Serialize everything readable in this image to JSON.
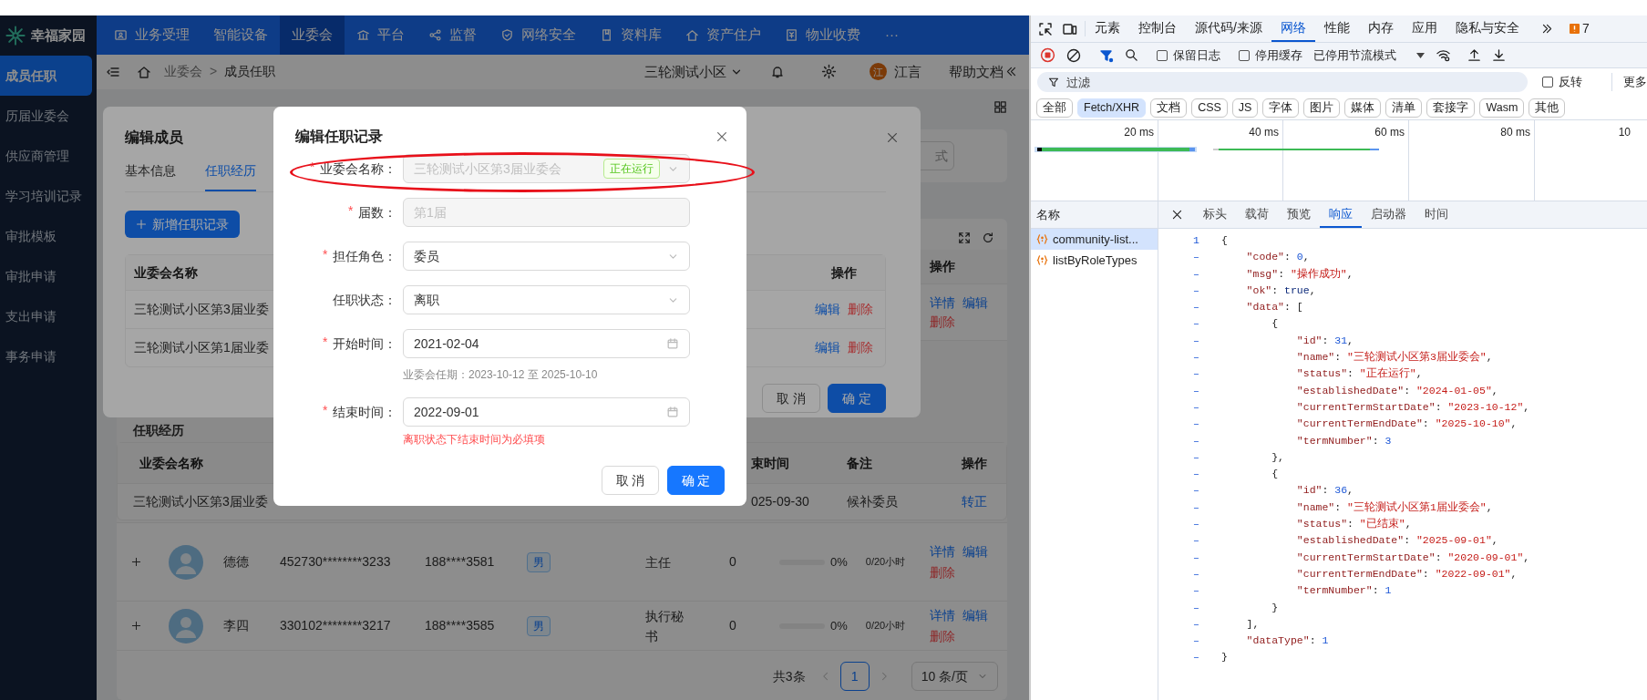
{
  "sidebar": {
    "logo": "幸福家园",
    "items": [
      {
        "label": "成员任职",
        "selected": true
      },
      {
        "label": "历届业委会",
        "selected": false
      },
      {
        "label": "供应商管理",
        "selected": false
      },
      {
        "label": "学习培训记录",
        "selected": false
      },
      {
        "label": "审批模板",
        "selected": false
      },
      {
        "label": "审批申请",
        "selected": false
      },
      {
        "label": "支出申请",
        "selected": false
      },
      {
        "label": "事务申请",
        "selected": false
      }
    ]
  },
  "top_nav": {
    "items": [
      {
        "label": "业务受理",
        "selected": false
      },
      {
        "label": "智能设备",
        "selected": false
      },
      {
        "label": "业委会",
        "selected": true
      },
      {
        "label": "平台",
        "selected": false
      },
      {
        "label": "监督",
        "selected": false
      },
      {
        "label": "网络安全",
        "selected": false
      },
      {
        "label": "资料库",
        "selected": false
      },
      {
        "label": "资产住户",
        "selected": false
      },
      {
        "label": "物业收费",
        "selected": false
      }
    ],
    "more": "···"
  },
  "header": {
    "breadcrumb": [
      "业委会",
      "成员任职"
    ],
    "separator": ">",
    "community": "三轮测试小区",
    "avatar": "江",
    "user": "江言",
    "help": "帮助文档"
  },
  "background": {
    "search_value": "式",
    "member_table": {
      "action_header": "操作",
      "first_row_actions": [
        {
          "label": "详情",
          "kind": "link"
        },
        {
          "label": "编辑",
          "kind": "link"
        },
        {
          "label": "删除",
          "kind": "danger"
        }
      ],
      "history": {
        "title": "任职经历",
        "columns": [
          "业委会名称",
          "束时间",
          "备注",
          "操作"
        ],
        "rows": [
          {
            "name": "三轮测试小区第3届业委",
            "end": "025-09-30",
            "note": "候补委员",
            "action": "转正"
          }
        ]
      },
      "rows": [
        {
          "name": "德德",
          "id_number": "452730********3233",
          "phone": "188****3581",
          "gender": "男",
          "role": "主任",
          "count": "0",
          "level": 0,
          "percent": "0%",
          "hours": "0/20小时",
          "actions": [
            {
              "label": "详情",
              "kind": "link"
            },
            {
              "label": "编辑",
              "kind": "link"
            },
            {
              "label": "删除",
              "kind": "danger"
            }
          ]
        },
        {
          "name": "李四",
          "id_number": "330102********3217",
          "phone": "188****3585",
          "gender": "男",
          "role": "执行秘书",
          "count": "0",
          "level": 0,
          "percent": "0%",
          "hours": "0/20小时",
          "actions": [
            {
              "label": "详情",
              "kind": "link"
            },
            {
              "label": "编辑",
              "kind": "link"
            },
            {
              "label": "删除",
              "kind": "danger"
            }
          ]
        }
      ]
    },
    "pagination": {
      "total": "共3条",
      "pages": [
        {
          "label": "1",
          "selected": true
        }
      ],
      "page_size": "10 条/页"
    }
  },
  "member_modal": {
    "title": "编辑成员",
    "tabs": [
      {
        "label": "基本信息",
        "selected": false
      },
      {
        "label": "任职经历",
        "selected": true
      }
    ],
    "add_button": "新增任职记录",
    "table": {
      "columns": [
        "业委会名称",
        "操作"
      ],
      "rows": [
        {
          "name": "三轮测试小区第3届业委",
          "actions": [
            {
              "label": "编辑",
              "kind": "link"
            },
            {
              "label": "删除",
              "kind": "danger"
            }
          ]
        },
        {
          "name": "三轮测试小区第1届业委",
          "actions": [
            {
              "label": "编辑",
              "kind": "link"
            },
            {
              "label": "删除",
              "kind": "danger"
            }
          ]
        }
      ]
    },
    "buttons": [
      {
        "label": "取 消",
        "kind": "default"
      },
      {
        "label": "确 定",
        "kind": "primary"
      }
    ]
  },
  "record_modal": {
    "title": "编辑任职记录",
    "fields": [
      {
        "mark": "*",
        "label": "业委会名称：",
        "kind": "select",
        "value": "三轮测试小区第3届业委会",
        "disabled": true,
        "tag": "正在运行"
      },
      {
        "mark": "*",
        "label": "届数：",
        "kind": "input",
        "value": "第1届",
        "disabled": true
      },
      {
        "mark": "*",
        "label": "担任角色：",
        "kind": "select",
        "value": "委员",
        "disabled": false
      },
      {
        "label": "任职状态：",
        "kind": "select",
        "value": "离职",
        "disabled": false
      },
      {
        "mark": "*",
        "label": "开始时间：",
        "kind": "date",
        "value": "2021-02-04",
        "disabled": false,
        "help": "业委会任期：2023-10-12 至 2025-10-10"
      },
      {
        "mark": "*",
        "label": "结束时间：",
        "kind": "date",
        "value": "2022-09-01",
        "disabled": false,
        "error": "离职状态下结束时间为必填项"
      }
    ],
    "buttons": [
      {
        "label": "取 消",
        "kind": "default"
      },
      {
        "label": "确 定",
        "kind": "primary"
      }
    ]
  },
  "devtools": {
    "tabs": [
      {
        "label": "元素",
        "selected": false
      },
      {
        "label": "控制台",
        "selected": false
      },
      {
        "label": "源代码/来源",
        "selected": false
      },
      {
        "label": "网络",
        "selected": true
      },
      {
        "label": "性能",
        "selected": false
      },
      {
        "label": "内存",
        "selected": false
      },
      {
        "label": "应用",
        "selected": false
      },
      {
        "label": "隐私与安全",
        "selected": false
      }
    ],
    "issues": "7",
    "checkboxes": [
      {
        "label": "保留日志",
        "checked": false
      },
      {
        "label": "停用缓存",
        "checked": false
      }
    ],
    "throttle": "已停用节流模式",
    "filter": {
      "placeholder": "过滤",
      "invert": {
        "label": "反转",
        "checked": false
      },
      "more": "更多"
    },
    "type_filters": [
      {
        "label": "全部",
        "selected": false
      },
      {
        "label": "Fetch/XHR",
        "selected": true
      },
      {
        "label": "文档",
        "selected": false
      },
      {
        "label": "CSS",
        "selected": false
      },
      {
        "label": "JS",
        "selected": false
      },
      {
        "label": "字体",
        "selected": false
      },
      {
        "label": "图片",
        "selected": false
      },
      {
        "label": "媒体",
        "selected": false
      },
      {
        "label": "清单",
        "selected": false
      },
      {
        "label": "套接字",
        "selected": false
      },
      {
        "label": "Wasm",
        "selected": false
      },
      {
        "label": "其他",
        "selected": false
      }
    ],
    "timeline_labels": [
      "20 ms",
      "40 ms",
      "60 ms",
      "80 ms",
      "10"
    ],
    "requests": {
      "header": "名称",
      "items": [
        {
          "name": "community-list...",
          "selected": true
        },
        {
          "name": "listByRoleTypes",
          "selected": false
        }
      ]
    },
    "detail_tabs": [
      {
        "label": "标头",
        "selected": false
      },
      {
        "label": "载荷",
        "selected": false
      },
      {
        "label": "预览",
        "selected": false
      },
      {
        "label": "响应",
        "selected": true
      },
      {
        "label": "启动器",
        "selected": false
      },
      {
        "label": "时间",
        "selected": false
      }
    ],
    "response_lines": [
      {
        "gutter": "1",
        "text": "{"
      },
      {
        "gutter": "–",
        "text": "    \"code\": 0,"
      },
      {
        "gutter": "–",
        "text": "    \"msg\": \"操作成功\","
      },
      {
        "gutter": "–",
        "text": "    \"ok\": true,"
      },
      {
        "gutter": "–",
        "text": "    \"data\": ["
      },
      {
        "gutter": "–",
        "text": "        {"
      },
      {
        "gutter": "–",
        "text": "            \"id\": 31,"
      },
      {
        "gutter": "–",
        "text": "            \"name\": \"三轮测试小区第3届业委会\","
      },
      {
        "gutter": "–",
        "text": "            \"status\": \"正在运行\","
      },
      {
        "gutter": "–",
        "text": "            \"establishedDate\": \"2024-01-05\","
      },
      {
        "gutter": "–",
        "text": "            \"currentTermStartDate\": \"2023-10-12\","
      },
      {
        "gutter": "–",
        "text": "            \"currentTermEndDate\": \"2025-10-10\","
      },
      {
        "gutter": "–",
        "text": "            \"termNumber\": 3"
      },
      {
        "gutter": "–",
        "text": "        },"
      },
      {
        "gutter": "–",
        "text": "        {"
      },
      {
        "gutter": "–",
        "text": "            \"id\": 36,"
      },
      {
        "gutter": "–",
        "text": "            \"name\": \"三轮测试小区第1届业委会\","
      },
      {
        "gutter": "–",
        "text": "            \"status\": \"已结束\","
      },
      {
        "gutter": "–",
        "text": "            \"establishedDate\": \"2025-09-01\","
      },
      {
        "gutter": "–",
        "text": "            \"currentTermStartDate\": \"2020-09-01\","
      },
      {
        "gutter": "–",
        "text": "            \"currentTermEndDate\": \"2022-09-01\","
      },
      {
        "gutter": "–",
        "text": "            \"termNumber\": 1"
      },
      {
        "gutter": "–",
        "text": "        }"
      },
      {
        "gutter": "–",
        "text": "    ],"
      },
      {
        "gutter": "–",
        "text": "    \"dataType\": 1"
      },
      {
        "gutter": "–",
        "text": "}"
      }
    ]
  }
}
